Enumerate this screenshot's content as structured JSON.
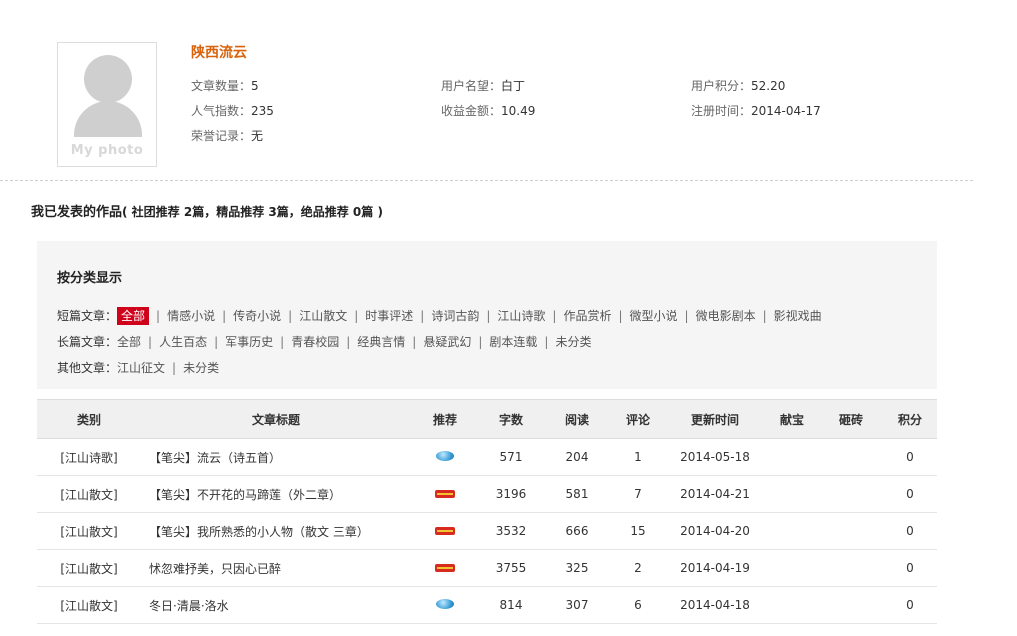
{
  "profile": {
    "avatar_caption": "My photo",
    "username": "陕西流云",
    "article_count_label": "文章数量：",
    "article_count": "5",
    "popularity_label": "人气指数：",
    "popularity": "235",
    "honor_label": "荣誉记录：",
    "honor": "无",
    "reputation_label": "用户名望：",
    "reputation": "白丁",
    "earnings_label": "收益金额：",
    "earnings": "10.49",
    "points_label": "用户积分：",
    "points": "52.20",
    "register_label": "注册时间：",
    "register_date": "2014-04-17"
  },
  "works": {
    "title": "我已发表的作品",
    "summary": "( 社团推荐 2篇，精品推荐 3篇，绝品推荐 0篇 )"
  },
  "categories": {
    "heading": "按分类显示",
    "rows": [
      {
        "label": "短篇文章：",
        "items": [
          "全部",
          "情感小说",
          "传奇小说",
          "江山散文",
          "时事评述",
          "诗词古韵",
          "江山诗歌",
          "作品赏析",
          "微型小说",
          "微电影剧本",
          "影视戏曲"
        ]
      },
      {
        "label": "长篇文章：",
        "items": [
          "全部",
          "人生百态",
          "军事历史",
          "青春校园",
          "经典言情",
          "悬疑武幻",
          "剧本连载",
          "未分类"
        ]
      },
      {
        "label": "其他文章：",
        "items": [
          "江山征文",
          "未分类"
        ]
      }
    ],
    "active": "全部"
  },
  "table": {
    "headers": [
      "类别",
      "文章标题",
      "推荐",
      "字数",
      "阅读",
      "评论",
      "更新时间",
      "献宝",
      "砸砖",
      "积分"
    ],
    "rows": [
      {
        "category": "[江山诗歌]",
        "title": "【笔尖】流云（诗五首）",
        "badge": "blue-medal-icon",
        "words": "571",
        "reads": "204",
        "comments": "1",
        "updated": "2014-05-18",
        "treasure": "",
        "bricks": "",
        "points": "0"
      },
      {
        "category": "[江山散文]",
        "title": "【笔尖】不开花的马蹄莲（外二章）",
        "badge": "red-medal-icon",
        "words": "3196",
        "reads": "581",
        "comments": "7",
        "updated": "2014-04-21",
        "treasure": "",
        "bricks": "",
        "points": "0"
      },
      {
        "category": "[江山散文]",
        "title": "【笔尖】我所熟悉的小人物（散文 三章）",
        "badge": "red-medal-icon",
        "words": "3532",
        "reads": "666",
        "comments": "15",
        "updated": "2014-04-20",
        "treasure": "",
        "bricks": "",
        "points": "0"
      },
      {
        "category": "[江山散文]",
        "title": "怵忽难抒美，只因心已醉",
        "badge": "red-medal-icon",
        "words": "3755",
        "reads": "325",
        "comments": "2",
        "updated": "2014-04-19",
        "treasure": "",
        "bricks": "",
        "points": "0"
      },
      {
        "category": "[江山散文]",
        "title": "冬日·清晨·洛水",
        "badge": "blue-medal-icon",
        "words": "814",
        "reads": "307",
        "comments": "6",
        "updated": "2014-04-18",
        "treasure": "",
        "bricks": "",
        "points": "0"
      }
    ]
  },
  "colors": {
    "username": "#d9620b",
    "active_category_bg": "#d0021b",
    "panel_bg": "#f5f5f5"
  }
}
